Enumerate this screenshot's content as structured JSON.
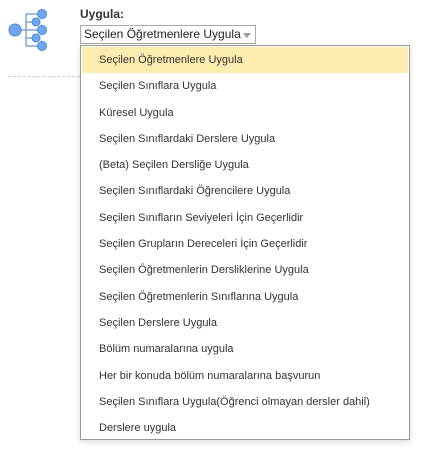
{
  "apply": {
    "label": "Uygula:",
    "selected_value": "Seçilen Öğretmenlere Uygula"
  },
  "dropdown": {
    "selected_index": 0,
    "items": [
      "Seçilen Öğretmenlere Uygula",
      "Seçilen Sınıflara Uygula",
      "Küresel Uygula",
      "Seçilen Sınıflardaki Derslere Uygula",
      "(Beta) Seçilen Dersliğe Uygula",
      "Seçilen Sınıflardaki Öğrencilere Uygula",
      "Seçilen Sınıfların Seviyeleri İçin Geçerlidir",
      "Seçilen Grupların Dereceleri İçin Geçerlidir",
      "Seçilen Öğretmenlerin Dersliklerine Uygula",
      "Seçilen Öğretmenlerin Sınıflarına Uygula",
      "Seçilen Derslere Uygula",
      "Bölüm numaralarına uygula",
      "Her bir konuda bölüm numaralarına başvurun",
      "Seçilen Sınıflara Uygula(Öğrenci olmayan dersler dahil)",
      "Derslere uygula"
    ]
  },
  "icons": {
    "tree": "hierarchy-tree-icon",
    "select_arrow": "chevron-down-icon"
  },
  "colors": {
    "icon_node": "#6fa8f1",
    "icon_line": "#7fa7d8",
    "selected_bg": "#fcedaf"
  }
}
